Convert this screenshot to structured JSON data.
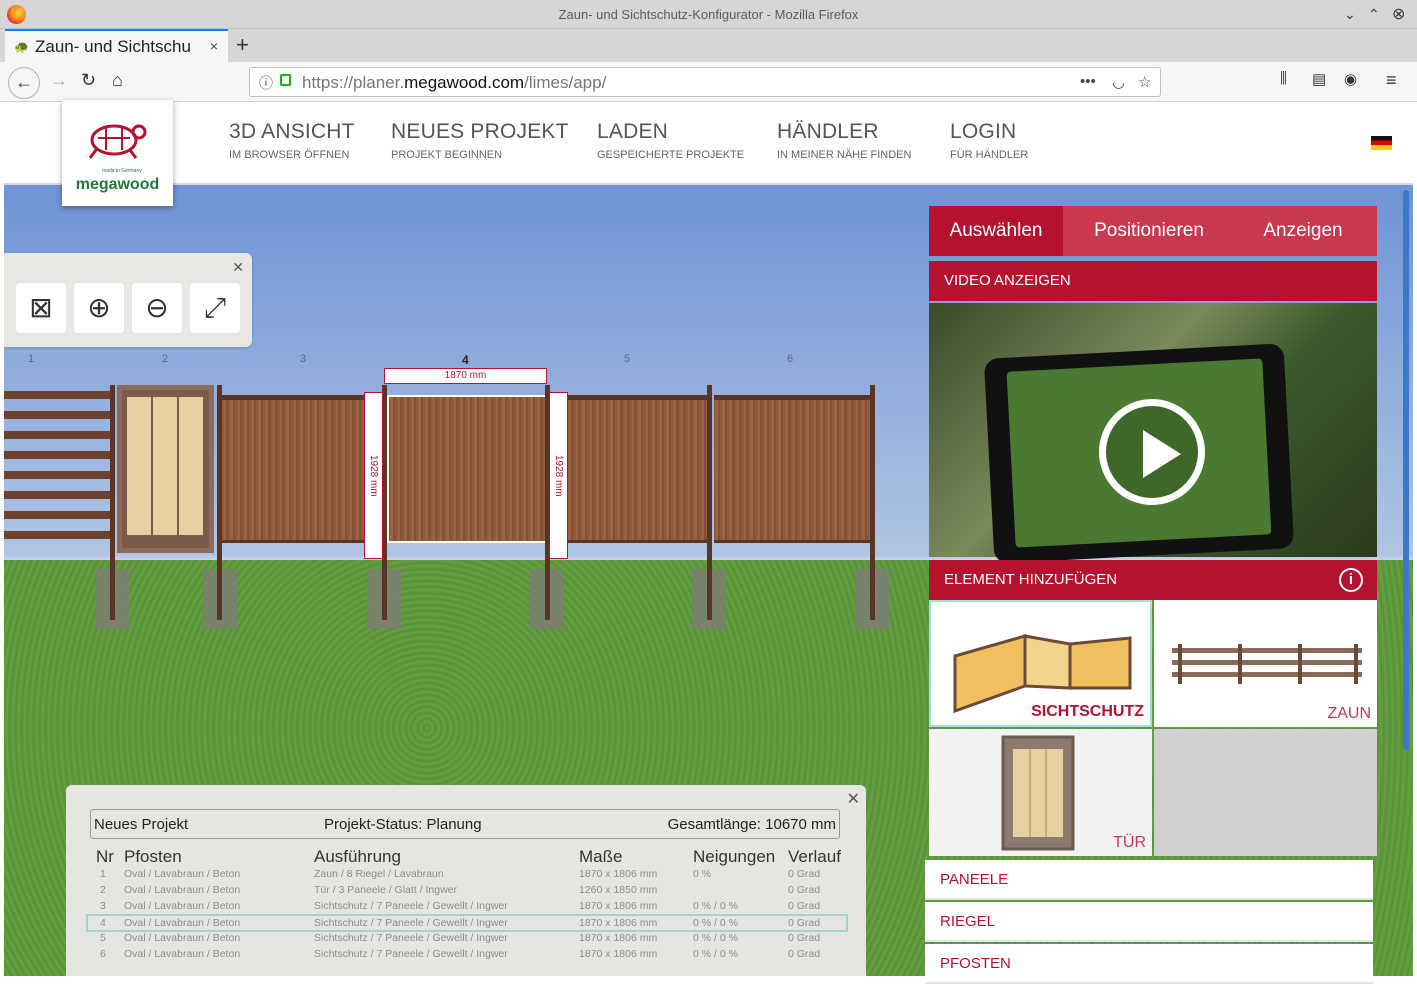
{
  "window": {
    "title": "Zaun- und Sichtschutz-Konfigurator - Mozilla Firefox"
  },
  "tab": {
    "label": "Zaun- und Sichtschu",
    "close": "×"
  },
  "newtab": "+",
  "url": {
    "prefix": "https://planer.",
    "domain": "megawood.com",
    "path": "/limes/app/"
  },
  "logo": {
    "brand": "megawood",
    "made": "made in Germany"
  },
  "menu": [
    {
      "h": "3D ANSICHT",
      "s": "IM BROWSER ÖFFNEN"
    },
    {
      "h": "NEUES PROJEKT",
      "s": "PROJEKT BEGINNEN"
    },
    {
      "h": "LADEN",
      "s": "GESPEICHERTE PROJEKTE"
    },
    {
      "h": "HÄNDLER",
      "s": "IN MEINER NÄHE FINDEN"
    },
    {
      "h": "LOGIN",
      "s": "FÜR HÄNDLER"
    }
  ],
  "columns": [
    "1",
    "2",
    "3",
    "4",
    "5",
    "6"
  ],
  "dims": {
    "width": "1870 mm",
    "height_left": "1928 mm",
    "height_right": "1928 mm"
  },
  "steps": [
    "Auswählen",
    "Positionieren",
    "Anzeigen"
  ],
  "video": {
    "header": "VIDEO ANZEIGEN"
  },
  "add": {
    "header": "ELEMENT HINZUFÜGEN",
    "tiles": [
      "SICHTSCHUTZ",
      "ZAUN",
      "TÜR"
    ]
  },
  "links": [
    "PANEELE",
    "RIEGEL",
    "PFOSTEN"
  ],
  "project": {
    "name": "Neues Projekt",
    "status": "Projekt-Status: Planung",
    "length": "Gesamtlänge: 10670 mm",
    "headers": [
      "Nr",
      "Pfosten",
      "Ausführung",
      "Maße",
      "Neigungen",
      "Verlauf"
    ],
    "rows": [
      [
        "1",
        "Oval / Lavabraun / Beton",
        "Zaun / 8 Riegel / Lavabraun",
        "1870 x 1806 mm",
        "0 %",
        "0 Grad"
      ],
      [
        "2",
        "Oval / Lavabraun / Beton",
        "Tür / 3 Paneele / Glatt / Ingwer",
        "1260 x 1850 mm",
        "",
        "0 Grad"
      ],
      [
        "3",
        "Oval / Lavabraun / Beton",
        "Sichtschutz / 7 Paneele / Gewellt / Ingwer",
        "1870 x 1806 mm",
        "0 % / 0 %",
        "0 Grad"
      ],
      [
        "4",
        "Oval / Lavabraun / Beton",
        "Sichtschutz / 7 Paneele / Gewellt / Ingwer",
        "1870 x 1806 mm",
        "0 % / 0 %",
        "0 Grad"
      ],
      [
        "5",
        "Oval / Lavabraun / Beton",
        "Sichtschutz / 7 Paneele / Gewellt / Ingwer",
        "1870 x 1806 mm",
        "0 % / 0 %",
        "0 Grad"
      ],
      [
        "6",
        "Oval / Lavabraun / Beton",
        "Sichtschutz / 7 Paneele / Gewellt / Ingwer",
        "1870 x 1806 mm",
        "0 % / 0 %",
        "0 Grad"
      ]
    ]
  },
  "colors": {
    "accent": "#b4122e",
    "accent_light": "#c8384f"
  }
}
